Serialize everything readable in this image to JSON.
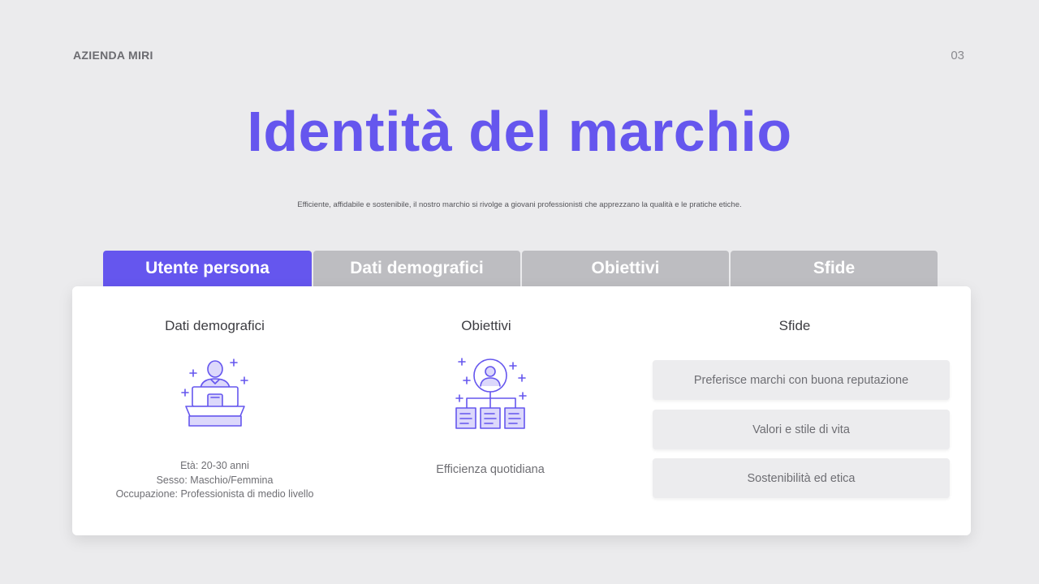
{
  "header": {
    "brand": "AZIENDA MIRI",
    "page_number": "03"
  },
  "title": "Identità del marchio",
  "subtitle": "Efficiente, affidabile e sostenibile, il nostro marchio si rivolge a giovani professionisti che apprezzano la qualità e le pratiche etiche.",
  "tabs": [
    {
      "label": "Utente persona",
      "active": true
    },
    {
      "label": "Dati demografici",
      "active": false
    },
    {
      "label": "Obiettivi",
      "active": false
    },
    {
      "label": "Sfide",
      "active": false
    }
  ],
  "card": {
    "demographics": {
      "title": "Dati demografici",
      "icon": "person-at-desk-icon",
      "lines": [
        "Età: 20-30 anni",
        "Sesso: Maschio/Femmina",
        "Occupazione: Professionista di medio livello"
      ]
    },
    "goals": {
      "title": "Obiettivi",
      "icon": "person-hierarchy-icon",
      "text": "Efficienza quotidiana"
    },
    "challenges": {
      "title": "Sfide",
      "items": [
        "Preferisce marchi con buona reputazione",
        "Valori e stile di vita",
        "Sostenibilità ed etica"
      ]
    }
  },
  "colors": {
    "accent": "#6556ee",
    "background": "#ebebed",
    "tab_inactive": "#bdbdc1",
    "icon_stroke": "#6556ee",
    "icon_fill": "#dcd8fb"
  }
}
